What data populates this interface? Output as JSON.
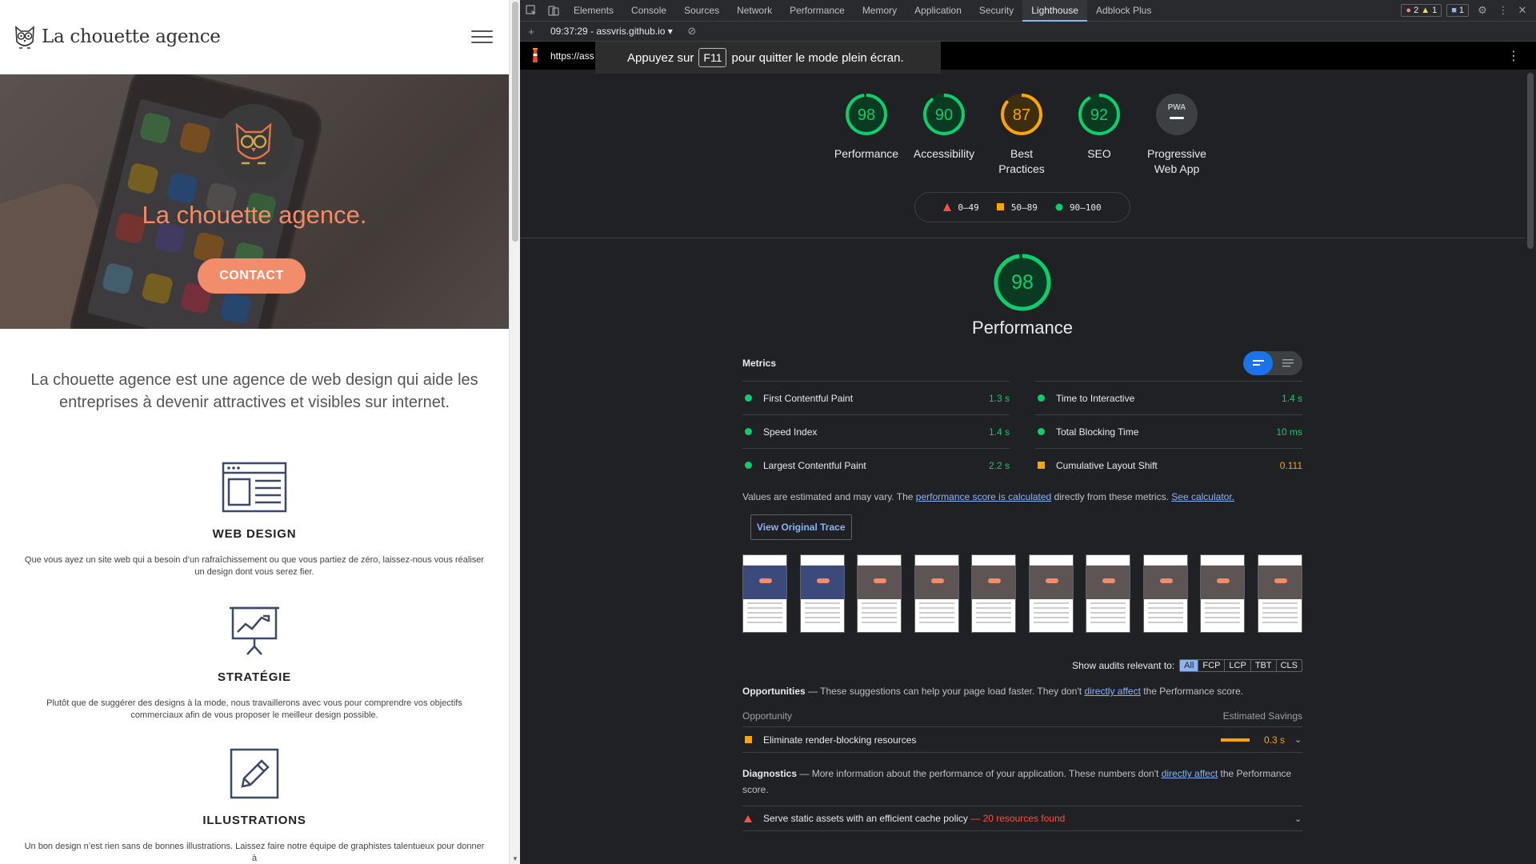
{
  "site": {
    "logo_text": "La chouette agence",
    "hero_title": "La chouette agence.",
    "contact_label": "CONTACT",
    "intro": "La chouette agence est une agence de web design qui aide les entreprises à devenir attractives et visibles sur internet.",
    "services": [
      {
        "title": "WEB DESIGN",
        "text": "Que vous ayez un site web qui a besoin d’un rafraîchissement ou que vous partiez de zéro, laissez-nous vous réaliser un design dont vous serez fier."
      },
      {
        "title": "STRATÉGIE",
        "text": "Plutôt que de suggérer des designs à la mode, nous travaillerons avec vous pour comprendre vos objectifs commerciaux afin de vous proposer le meilleur design possible."
      },
      {
        "title": "ILLUSTRATIONS",
        "text": "Un bon design n’est rien sans de bonnes illustrations. Laissez faire notre équipe de graphistes talentueux pour donner à"
      }
    ]
  },
  "devtools": {
    "tabs": [
      "Elements",
      "Console",
      "Sources",
      "Network",
      "Performance",
      "Memory",
      "Application",
      "Security",
      "Lighthouse",
      "Adblock Plus"
    ],
    "active_tab": "Lighthouse",
    "errors_count": "2",
    "warnings_count": "1",
    "messages_count": "1",
    "report_label": "09:37:29 - assvris.github.io",
    "url": "https://ass",
    "fullscreen_toast": {
      "before": "Appuyez sur",
      "key": "F11",
      "after": "pour quitter le mode plein écran."
    }
  },
  "lighthouse": {
    "gauges": [
      {
        "score": "98",
        "label": "Performance",
        "color": "#0cce6b",
        "fraction": 0.98
      },
      {
        "score": "90",
        "label": "Accessibility",
        "color": "#0cce6b",
        "fraction": 0.9
      },
      {
        "score": "87",
        "label": "Best Practices",
        "color": "#ffa400",
        "fraction": 0.87
      },
      {
        "score": "92",
        "label": "SEO",
        "color": "#0cce6b",
        "fraction": 0.92
      },
      {
        "score": "PWA",
        "label": "Progressive Web App",
        "color": "#9aa0a6",
        "fraction": 0
      }
    ],
    "legend": [
      {
        "range": "0–49",
        "color": "#ff4e42"
      },
      {
        "range": "50–89",
        "color": "#ffa400"
      },
      {
        "range": "90–100",
        "color": "#0cce6b"
      }
    ],
    "perf_score": "98",
    "perf_title": "Performance",
    "metrics_title": "Metrics",
    "metrics": [
      {
        "name": "First Contentful Paint",
        "value": "1.3 s",
        "status": "pass"
      },
      {
        "name": "Time to Interactive",
        "value": "1.4 s",
        "status": "pass"
      },
      {
        "name": "Speed Index",
        "value": "1.4 s",
        "status": "pass"
      },
      {
        "name": "Total Blocking Time",
        "value": "10 ms",
        "status": "pass"
      },
      {
        "name": "Largest Contentful Paint",
        "value": "2.2 s",
        "status": "pass"
      },
      {
        "name": "Cumulative Layout Shift",
        "value": "0.111",
        "status": "average"
      }
    ],
    "note_before": "Values are estimated and may vary. The",
    "note_link1": "performance score is calculated",
    "note_middle": "directly from these metrics.",
    "note_link2": "See calculator.",
    "trace_label": "View Original Trace",
    "filter_label": "Show audits relevant to:",
    "filter_chips": [
      "All",
      "FCP",
      "LCP",
      "TBT",
      "CLS"
    ],
    "opportunities_title": "Opportunities",
    "opportunities_desc_before": "— These suggestions can help your page load faster. They don't",
    "opportunities_link": "directly affect",
    "opportunities_desc_after": "the Performance score.",
    "opp_col_left": "Opportunity",
    "opp_col_right": "Estimated Savings",
    "opportunity_item": {
      "name": "Eliminate render-blocking resources",
      "savings": "0.3 s"
    },
    "diagnostics_title": "Diagnostics",
    "diagnostics_desc_before": "— More information about the performance of your application. These numbers don't",
    "diagnostics_link": "directly affect",
    "diagnostics_desc_after": "the Performance score.",
    "diagnostic_item": {
      "name": "Serve static assets with an efficient cache policy",
      "detail": "— 20 resources found"
    }
  }
}
